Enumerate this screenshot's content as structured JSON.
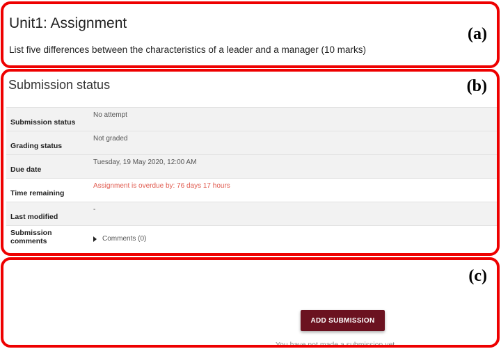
{
  "assignment": {
    "title": "Unit1: Assignment",
    "intro": "List five differences between the characteristics of a leader and a manager  (10 marks)"
  },
  "figure_labels": {
    "a": "(a)",
    "b": "(b)",
    "c": "(c)"
  },
  "submission": {
    "heading": "Submission status",
    "rows": [
      {
        "label": "Submission status",
        "value": "No attempt"
      },
      {
        "label": "Grading status",
        "value": "Not graded"
      },
      {
        "label": "Due date",
        "value": "Tuesday, 19 May 2020, 12:00 AM"
      },
      {
        "label": "Time remaining",
        "value": "Assignment is overdue by: 76 days 17 hours"
      },
      {
        "label": "Last modified",
        "value": "-"
      },
      {
        "label": "Submission comments",
        "value": "Comments (0)"
      }
    ]
  },
  "actions": {
    "add_submission_label": "ADD SUBMISSION",
    "no_submission_text": "You have not made a submission yet."
  },
  "colors": {
    "annotation_border": "#ee0000",
    "button_bg": "#6b1220",
    "overdue_text": "#e05a4e",
    "row_shaded": "#f2f2f2"
  }
}
